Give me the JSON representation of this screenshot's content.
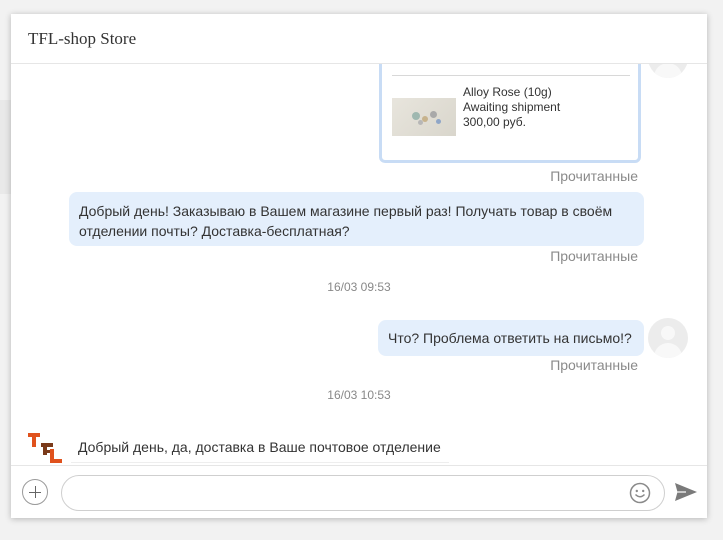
{
  "header": {
    "title": "TFL-shop Store"
  },
  "order_card": {
    "product": "Alloy Rose (10g)",
    "status": "Awaiting shipment",
    "price": "300,00 руб."
  },
  "messages": [
    {
      "direction": "outgoing",
      "type": "order",
      "read_status": "Прочитанные"
    },
    {
      "direction": "outgoing",
      "text": "Добрый день! Заказываю в Вашем магазине первый раз! Получать товар в своём отделении почты? Доставка-бесплатная?",
      "read_status": "Прочитанные"
    },
    {
      "type": "timestamp",
      "text": "16/03 09:53"
    },
    {
      "direction": "outgoing",
      "text": "Что? Проблема ответить на письмо!?",
      "read_status": "Прочитанные"
    },
    {
      "type": "timestamp",
      "text": "16/03 10:53"
    },
    {
      "direction": "incoming",
      "sender_logo": "TFL",
      "text": "Добрый день, да, доставка в Ваше почтовое отделение"
    }
  ],
  "composer": {
    "value": "",
    "placeholder": ""
  },
  "icons": {
    "add": "plus-circle-icon",
    "emoji": "smiley-icon",
    "send": "paper-plane-icon",
    "avatar": "user-avatar-icon"
  },
  "colors": {
    "outgoing_bubble": "#e4effc",
    "order_card_border": "#c8dcf5",
    "logo_orange": "#e0521d",
    "logo_dark": "#7a3a1a"
  }
}
